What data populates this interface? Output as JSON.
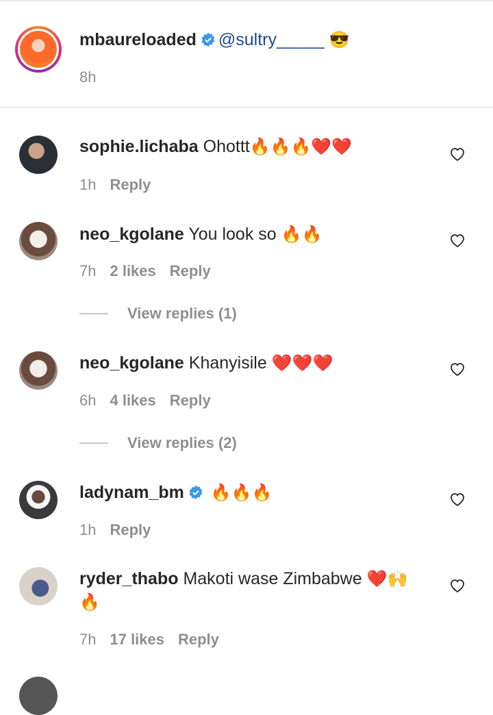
{
  "caption": {
    "username": "mbaureloaded",
    "mention": "@sultry_____",
    "emoji": "😎",
    "time": "8h"
  },
  "comments": [
    {
      "username": "sophie.lichaba",
      "text": "Ohottt",
      "emoji": "🔥🔥🔥❤️❤️",
      "time": "1h",
      "likes": "",
      "reply": "Reply",
      "verified": false,
      "view_replies": ""
    },
    {
      "username": "neo_kgolane",
      "text": "You look so",
      "emoji": "🔥🔥",
      "time": "7h",
      "likes": "2 likes",
      "reply": "Reply",
      "verified": false,
      "view_replies": "View replies (1)"
    },
    {
      "username": "neo_kgolane",
      "text": "Khanyisile",
      "emoji": "❤️❤️❤️",
      "time": "6h",
      "likes": "4 likes",
      "reply": "Reply",
      "verified": false,
      "view_replies": "View replies (2)"
    },
    {
      "username": "ladynam_bm",
      "text": "",
      "emoji": "🔥🔥🔥",
      "time": "1h",
      "likes": "",
      "reply": "Reply",
      "verified": true,
      "view_replies": ""
    },
    {
      "username": "ryder_thabo",
      "text": "Makoti wase Zimbabwe",
      "emoji": "❤️🙌",
      "emoji_line2": "🔥",
      "time": "7h",
      "likes": "17 likes",
      "reply": "Reply",
      "verified": false,
      "view_replies": ""
    }
  ],
  "icons": {
    "heart": "heart-outline-icon",
    "verified": "verified-badge-icon"
  },
  "colors": {
    "verified": "#3897f0",
    "meta": "#8e8e8e",
    "mention": "#1b4b8f"
  }
}
